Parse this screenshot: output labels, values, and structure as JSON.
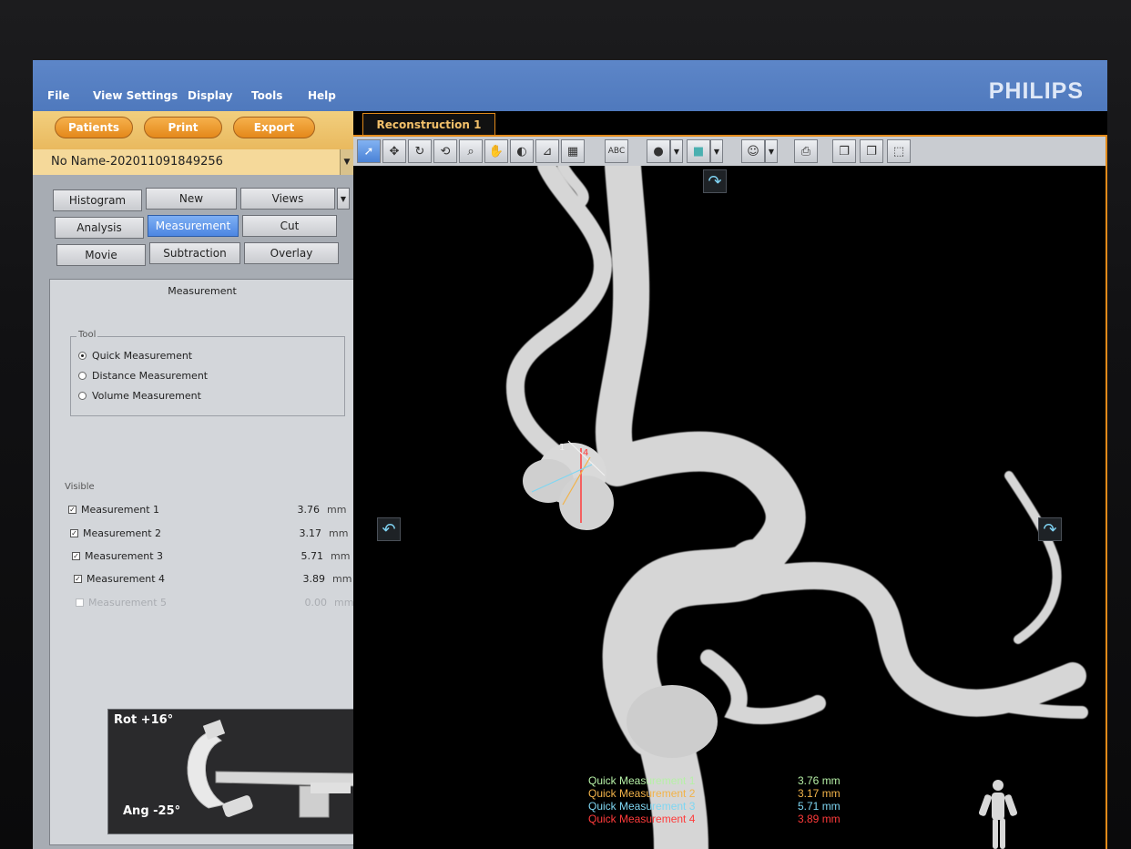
{
  "brand": "PHILIPS",
  "menu": [
    "File",
    "View Settings",
    "Display",
    "Tools",
    "Help"
  ],
  "nav_buttons": {
    "patients": "Patients",
    "print": "Print",
    "export": "Export"
  },
  "study": {
    "name": "No Name-202011091849256"
  },
  "function_buttons": [
    [
      "Histogram",
      "New",
      "Views"
    ],
    [
      "Analysis",
      "Measurement",
      "Cut"
    ],
    [
      "Movie",
      "Subtraction",
      "Overlay"
    ]
  ],
  "active_function": "Measurement",
  "measurement_panel": {
    "title": "Measurement",
    "tool_label": "Tool",
    "tools": [
      {
        "label": "Quick Measurement",
        "selected": true
      },
      {
        "label": "Distance Measurement",
        "selected": false
      },
      {
        "label": "Volume Measurement",
        "selected": false
      }
    ],
    "visible_label": "Visible",
    "measurements": [
      {
        "name": "Measurement 1",
        "value": "3.76",
        "unit": "mm",
        "checked": true,
        "enabled": true
      },
      {
        "name": "Measurement 2",
        "value": "3.17",
        "unit": "mm",
        "checked": true,
        "enabled": true
      },
      {
        "name": "Measurement 3",
        "value": "5.71",
        "unit": "mm",
        "checked": true,
        "enabled": true
      },
      {
        "name": "Measurement 4",
        "value": "3.89",
        "unit": "mm",
        "checked": true,
        "enabled": true
      },
      {
        "name": "Measurement 5",
        "value": "0.00",
        "unit": "mm",
        "checked": false,
        "enabled": false
      }
    ]
  },
  "orientation": {
    "rot": "Rot  +16°",
    "ang": "Ang  -25°"
  },
  "viewport": {
    "tab": "Reconstruction 1",
    "toolbar_text_button": "ABC",
    "markers": [
      "1",
      "4"
    ],
    "legend": [
      {
        "name": "Quick Measurement 1",
        "value": "3.76 mm",
        "color": "#b6f0a6"
      },
      {
        "name": "Quick Measurement 2",
        "value": "3.17 mm",
        "color": "#f2b34a"
      },
      {
        "name": "Quick Measurement 3",
        "value": "5.71 mm",
        "color": "#7fd6f2"
      },
      {
        "name": "Quick Measurement 4",
        "value": "3.89 mm",
        "color": "#ff3b3b"
      }
    ]
  },
  "colors": {
    "menubar": "#5d86c8",
    "accent_orange": "#e28a1a",
    "active_blue": "#4c86e2"
  }
}
